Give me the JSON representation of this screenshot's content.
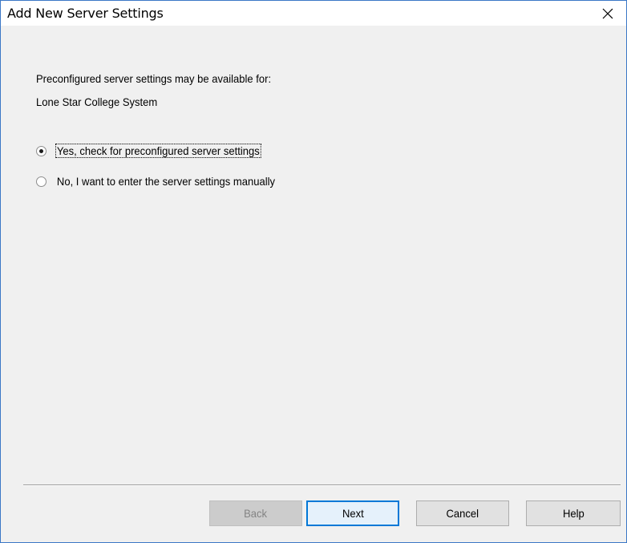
{
  "window": {
    "title": "Add New Server Settings"
  },
  "info": {
    "line1": "Preconfigured server settings may be available for:",
    "line2": "Lone Star College System"
  },
  "options": [
    {
      "label": "Yes, check for preconfigured server settings",
      "selected": true
    },
    {
      "label": "No, I want to enter the server settings manually",
      "selected": false
    }
  ],
  "buttons": {
    "back": "Back",
    "next": "Next",
    "cancel": "Cancel",
    "help": "Help"
  },
  "colors": {
    "window_border": "#3b78c6",
    "dialog_bg": "#f0f0f0",
    "default_button_border": "#0078d7"
  },
  "icons": {
    "close": "close-icon"
  }
}
